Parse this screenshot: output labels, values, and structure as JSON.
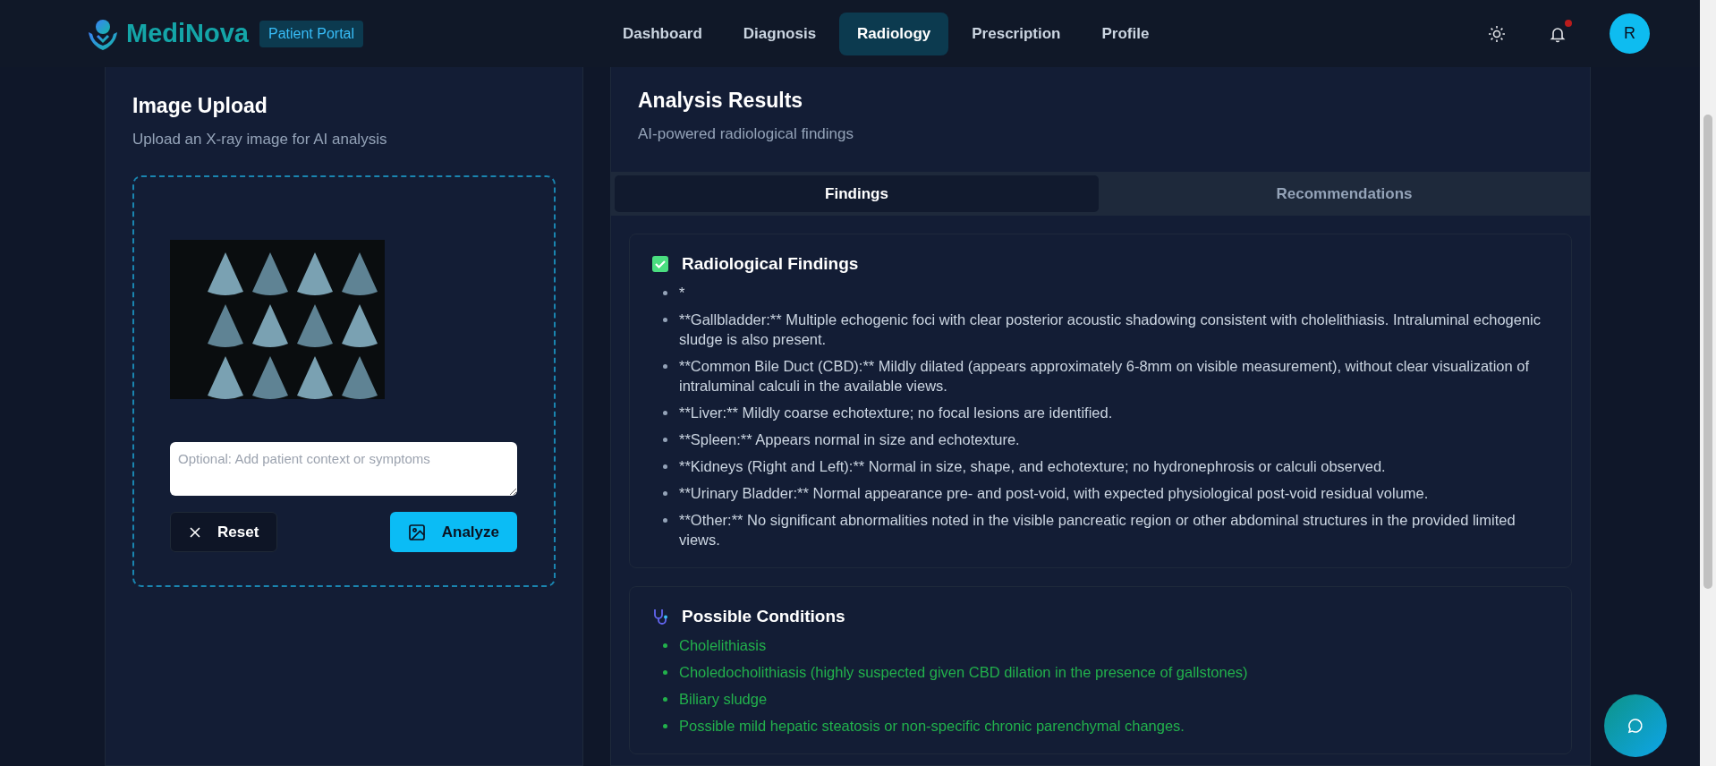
{
  "header": {
    "brand": "MediNova",
    "badge": "Patient Portal",
    "nav": [
      {
        "label": "Dashboard",
        "selected": false
      },
      {
        "label": "Diagnosis",
        "selected": false
      },
      {
        "label": "Radiology",
        "selected": true
      },
      {
        "label": "Prescription",
        "selected": false
      },
      {
        "label": "Profile",
        "selected": false
      }
    ],
    "notification_dot": true,
    "avatar": "R"
  },
  "upload": {
    "title": "Image Upload",
    "subtitle": "Upload an X-ray image for AI analysis",
    "context_placeholder": "Optional: Add patient context or symptoms",
    "reset_label": "Reset",
    "analyze_label": "Analyze"
  },
  "results": {
    "title": "Analysis Results",
    "subtitle": "AI-powered radiological findings",
    "tabs": [
      {
        "label": "Findings",
        "selected": true
      },
      {
        "label": "Recommendations",
        "selected": false
      }
    ],
    "sections": [
      {
        "kind": "findings",
        "title": "Radiological Findings",
        "items": [
          "*",
          "**Gallbladder:** Multiple echogenic foci with clear posterior acoustic shadowing consistent with cholelithiasis. Intraluminal echogenic sludge is also present.",
          "**Common Bile Duct (CBD):** Mildly dilated (appears approximately 6-8mm on visible measurement), without clear visualization of intraluminal calculi in the available views.",
          "**Liver:** Mildly coarse echotexture; no focal lesions are identified.",
          "**Spleen:** Appears normal in size and echotexture.",
          "**Kidneys (Right and Left):** Normal in size, shape, and echotexture; no hydronephrosis or calculi observed.",
          "**Urinary Bladder:** Normal appearance pre- and post-void, with expected physiological post-void residual volume.",
          "**Other:** No significant abnormalities noted in the visible pancreatic region or other abdominal structures in the provided limited views."
        ]
      },
      {
        "kind": "conditions",
        "title": "Possible Conditions",
        "items": [
          "Cholelithiasis",
          "Choledocholithiasis (highly suspected given CBD dilation in the presence of gallstones)",
          "Biliary sludge",
          "Possible mild hepatic steatosis or non-specific chronic parenchymal changes."
        ]
      }
    ]
  }
}
